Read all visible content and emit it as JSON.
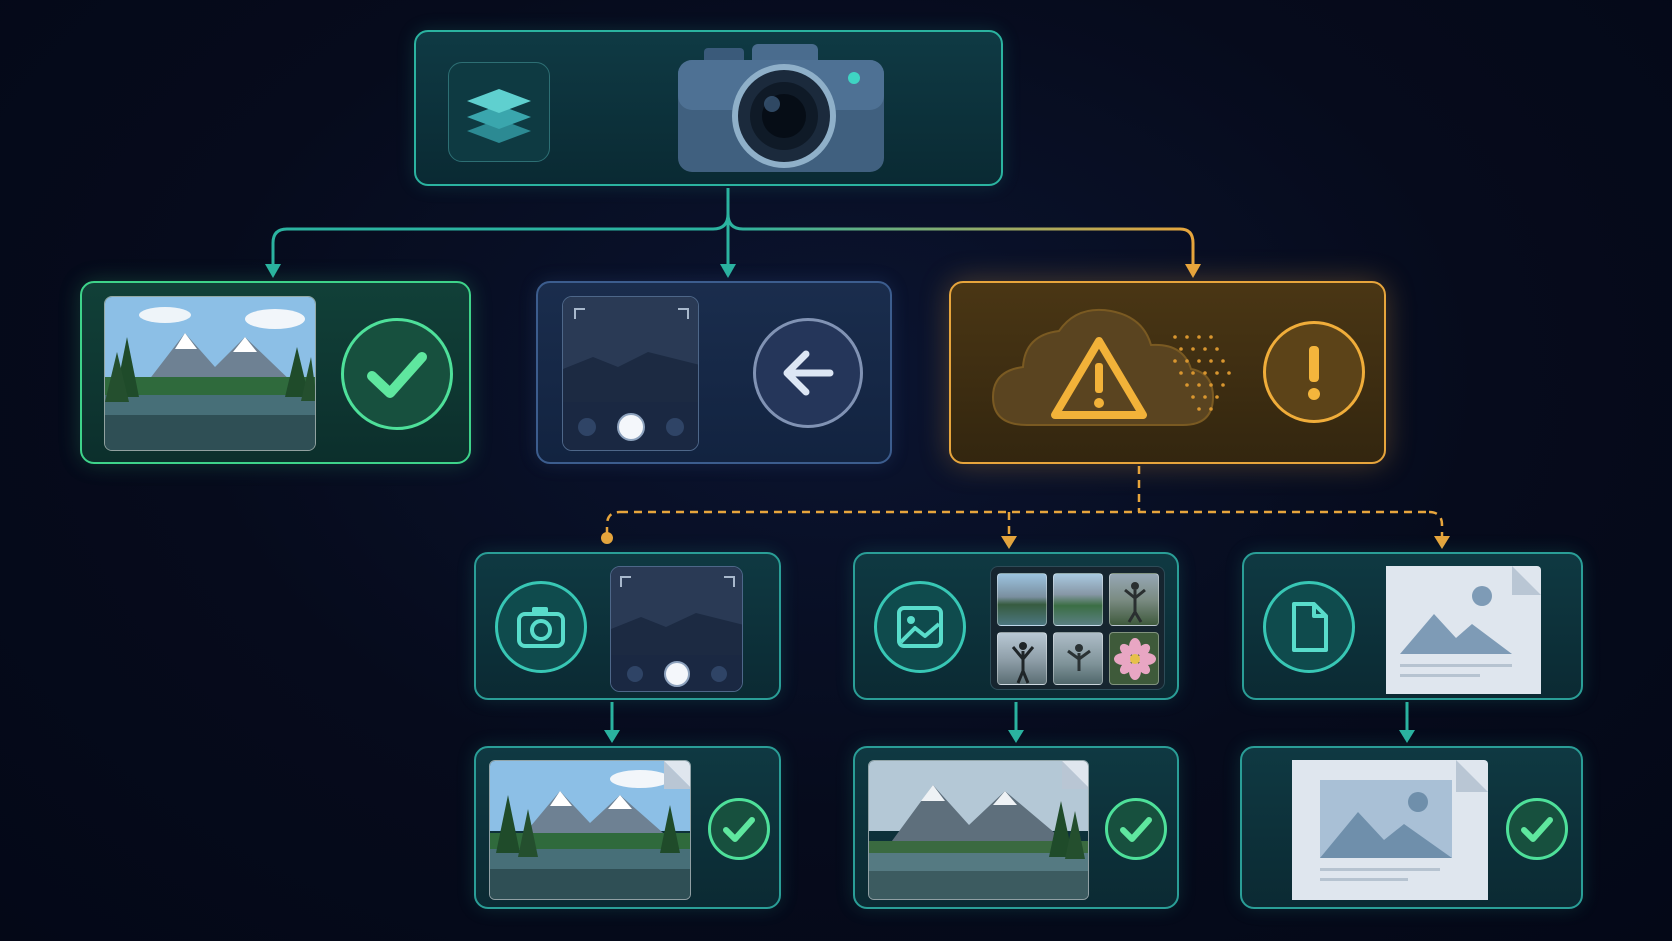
{
  "diagram": {
    "root": {
      "icons": [
        "layers-icon",
        "camera-icon"
      ]
    },
    "branches": [
      {
        "status": "success",
        "icons": [
          "landscape-photo",
          "check-icon"
        ],
        "color": "#3ed38a"
      },
      {
        "status": "cancelled",
        "icons": [
          "camera-viewfinder",
          "back-arrow-icon"
        ],
        "color": "#5b7cb8"
      },
      {
        "status": "warning",
        "icons": [
          "cloud-warning-icon",
          "exclamation-icon"
        ],
        "color": "#e7a53c"
      }
    ],
    "fallback_options": [
      {
        "source": "camera",
        "icons": [
          "camera-icon",
          "camera-viewfinder"
        ],
        "result_icons": [
          "landscape-photo",
          "check-icon"
        ]
      },
      {
        "source": "gallery",
        "icons": [
          "image-icon",
          "photo-grid"
        ],
        "result_icons": [
          "landscape-photo",
          "check-icon"
        ]
      },
      {
        "source": "file",
        "icons": [
          "file-icon",
          "image-document"
        ],
        "result_icons": [
          "image-document",
          "check-icon"
        ]
      }
    ],
    "colors": {
      "accent_teal": "#2bb3a0",
      "success_green": "#3ed38a",
      "warning_amber": "#e7a53c",
      "neutral_blue": "#3c5d8e",
      "background": "#060b1c"
    }
  }
}
